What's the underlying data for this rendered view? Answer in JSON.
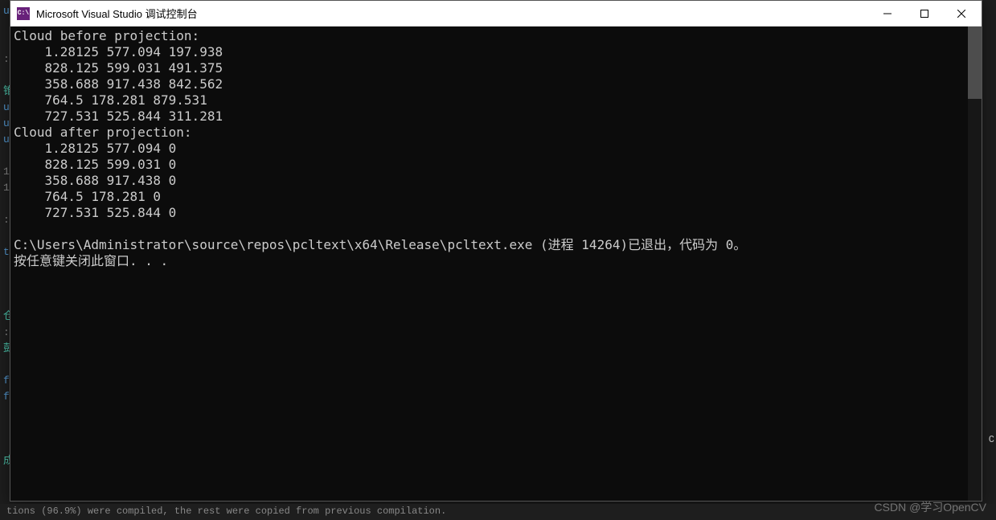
{
  "window": {
    "title": "Microsoft Visual Studio 调试控制台",
    "icon_text": "C:\\"
  },
  "console": {
    "lines": [
      "Cloud before projection:",
      "    1.28125 577.094 197.938",
      "    828.125 599.031 491.375",
      "    358.688 917.438 842.562",
      "    764.5 178.281 879.531",
      "    727.531 525.844 311.281",
      "Cloud after projection:",
      "    1.28125 577.094 0",
      "    828.125 599.031 0",
      "    358.688 917.438 0",
      "    764.5 178.281 0",
      "    727.531 525.844 0",
      "",
      "C:\\Users\\Administrator\\source\\repos\\pcltext\\x64\\Release\\pcltext.exe (进程 14264)已退出，代码为 0。",
      "按任意键关闭此窗口. . ."
    ]
  },
  "background": {
    "left_fragments": [
      "u",
      "",
      "",
      ":",
      "",
      "锥",
      "u",
      "u",
      "u",
      "",
      "1",
      "1",
      "",
      ":",
      "",
      "t",
      "",
      "",
      "",
      "仓",
      ":",
      "彭",
      "",
      "f",
      "f",
      "",
      "",
      "",
      "成"
    ],
    "bottom_status": "tions (96.9%) were compiled, the rest were copied from previous compilation.",
    "right_char": "C"
  },
  "watermark": "CSDN @学习OpenCV"
}
